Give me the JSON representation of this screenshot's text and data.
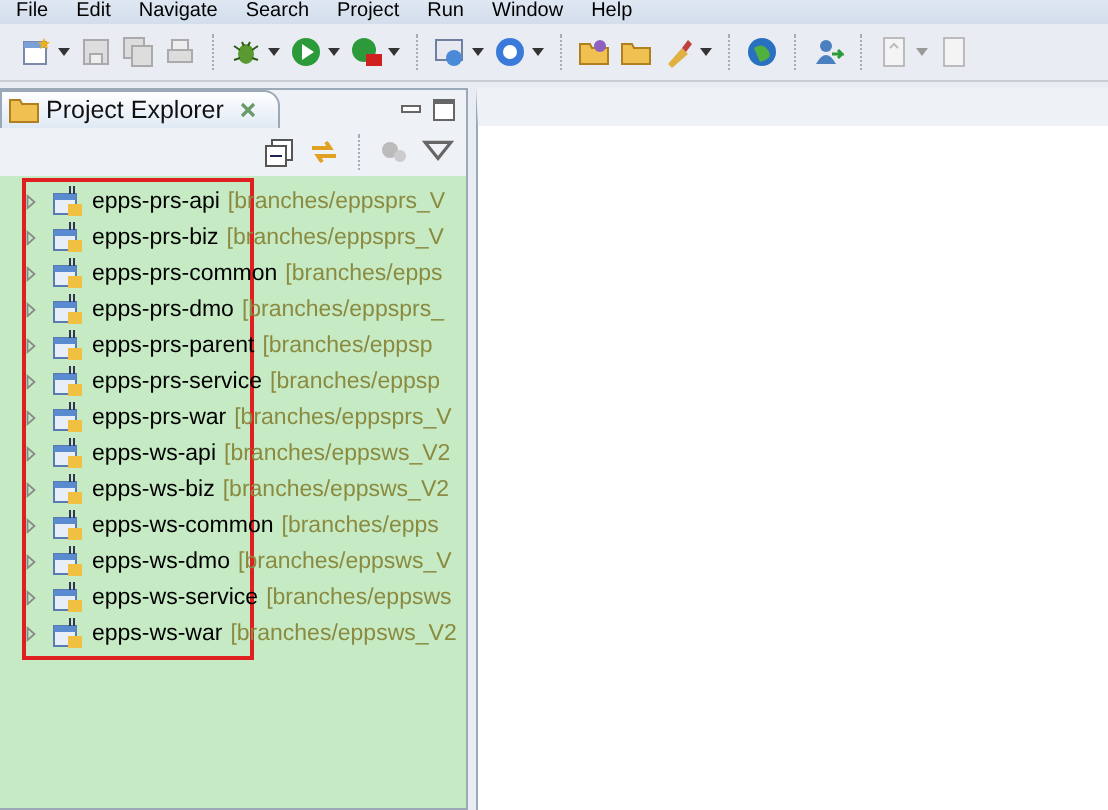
{
  "menu": [
    "File",
    "Edit",
    "Navigate",
    "Search",
    "Project",
    "Run",
    "Window",
    "Help"
  ],
  "explorer": {
    "title": "Project Explorer",
    "projects": [
      {
        "name": "epps-prs-api",
        "decoration": "[branches/eppsprs_V",
        "expanded": false
      },
      {
        "name": "epps-prs-biz",
        "decoration": "[branches/eppsprs_V",
        "expanded": false
      },
      {
        "name": "epps-prs-common",
        "decoration": "[branches/epps",
        "expanded": false
      },
      {
        "name": "epps-prs-dmo",
        "decoration": "[branches/eppsprs_",
        "expanded": false
      },
      {
        "name": "epps-prs-parent",
        "decoration": "[branches/eppsp",
        "expanded": false
      },
      {
        "name": "epps-prs-service",
        "decoration": "[branches/eppsp",
        "expanded": false
      },
      {
        "name": "epps-prs-war",
        "decoration": "[branches/eppsprs_V",
        "expanded": false
      },
      {
        "name": "epps-ws-api",
        "decoration": "[branches/eppsws_V2",
        "expanded": false
      },
      {
        "name": "epps-ws-biz",
        "decoration": "[branches/eppsws_V2",
        "expanded": false
      },
      {
        "name": "epps-ws-common",
        "decoration": "[branches/epps",
        "expanded": false
      },
      {
        "name": "epps-ws-dmo",
        "decoration": "[branches/eppsws_V",
        "expanded": false
      },
      {
        "name": "epps-ws-service",
        "decoration": "[branches/eppsws",
        "expanded": false
      },
      {
        "name": "epps-ws-war",
        "decoration": "[branches/eppsws_V2",
        "expanded": false
      }
    ]
  }
}
